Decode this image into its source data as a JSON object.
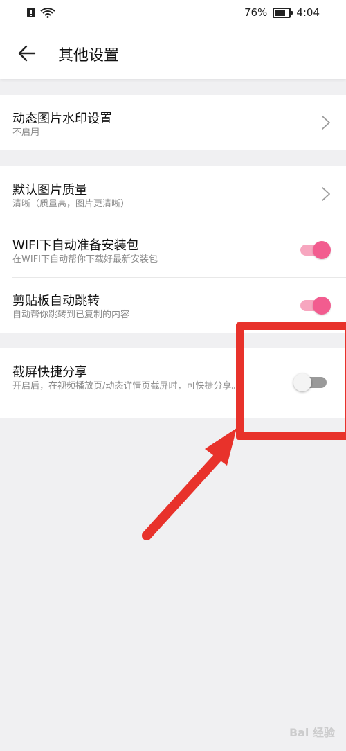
{
  "status_bar": {
    "battery": "76%",
    "time": "4:04"
  },
  "header": {
    "title": "其他设置"
  },
  "settings": [
    {
      "title": "动态图片水印设置",
      "subtitle": "不启用",
      "control": "chevron"
    },
    {
      "title": "默认图片质量",
      "subtitle": "清晰（质量高，图片更清晰）",
      "control": "chevron"
    },
    {
      "title": "WIFI下自动准备安装包",
      "subtitle": "在WIFI下自动帮你下载好最新安装包",
      "control": "toggle",
      "enabled": true
    },
    {
      "title": "剪贴板自动跳转",
      "subtitle": "自动帮你跳转到已复制的内容",
      "control": "toggle",
      "enabled": true
    },
    {
      "title": "截屏快捷分享",
      "subtitle": "开启后，在视频播放页/动态详情页截屏时，可快捷分享。",
      "control": "toggle",
      "enabled": false
    }
  ],
  "colors": {
    "toggle_on": "#f25c8f",
    "toggle_track_on": "#f7a6bf",
    "annotation": "#e8322b"
  },
  "watermark": "Bai 经验"
}
